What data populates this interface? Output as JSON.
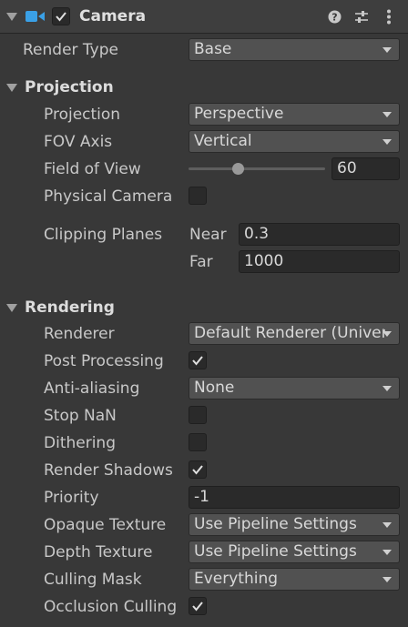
{
  "header": {
    "title": "Camera",
    "enabled": true
  },
  "render_type": {
    "label": "Render Type",
    "value": "Base"
  },
  "projection_section": {
    "title": "Projection",
    "projection": {
      "label": "Projection",
      "value": "Perspective"
    },
    "fov_axis": {
      "label": "FOV Axis",
      "value": "Vertical"
    },
    "field_of_view": {
      "label": "Field of View",
      "value": "60",
      "slider_fraction": 0.36
    },
    "physical_camera": {
      "label": "Physical Camera",
      "checked": false
    },
    "clipping_planes": {
      "label": "Clipping Planes",
      "near_label": "Near",
      "near_value": "0.3",
      "far_label": "Far",
      "far_value": "1000"
    }
  },
  "rendering_section": {
    "title": "Rendering",
    "renderer": {
      "label": "Renderer",
      "value": "Default Renderer (Universal"
    },
    "post_processing": {
      "label": "Post Processing",
      "checked": true
    },
    "anti_aliasing": {
      "label": "Anti-aliasing",
      "value": "None"
    },
    "stop_nan": {
      "label": "Stop NaN",
      "checked": false
    },
    "dithering": {
      "label": "Dithering",
      "checked": false
    },
    "render_shadows": {
      "label": "Render Shadows",
      "checked": true
    },
    "priority": {
      "label": "Priority",
      "value": "-1"
    },
    "opaque_texture": {
      "label": "Opaque Texture",
      "value": "Use Pipeline Settings"
    },
    "depth_texture": {
      "label": "Depth Texture",
      "value": "Use Pipeline Settings"
    },
    "culling_mask": {
      "label": "Culling Mask",
      "value": "Everything"
    },
    "occlusion_culling": {
      "label": "Occlusion Culling",
      "checked": true
    }
  }
}
